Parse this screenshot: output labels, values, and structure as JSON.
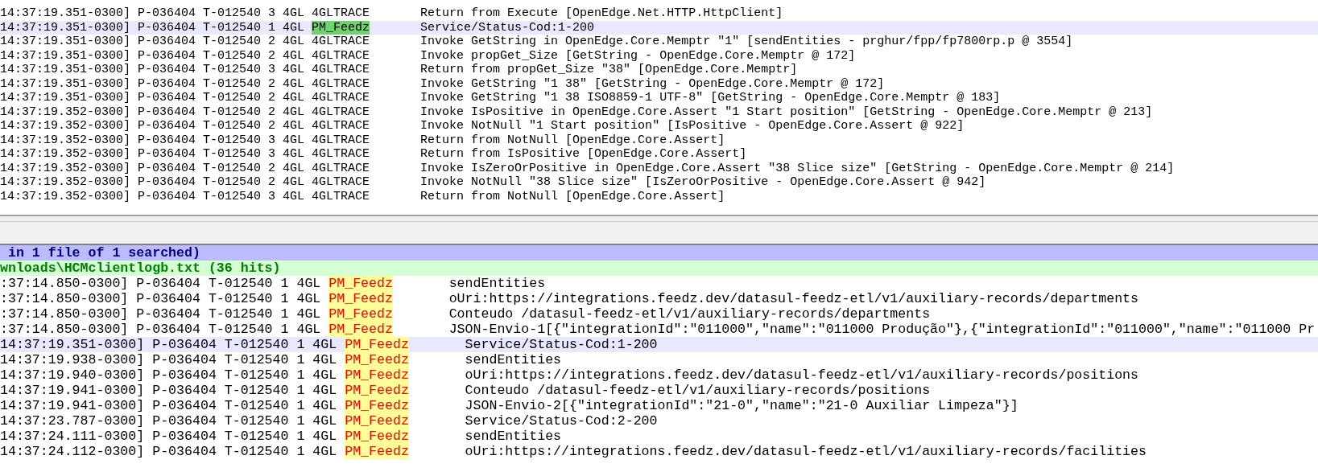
{
  "editor": {
    "lines": [
      {
        "head": "14:37:19.351-0300] P-036404 T-012540 3 4GL",
        "tag": "4GLTRACE",
        "highlighted": false,
        "message": "Return from Execute [OpenEdge.Net.HTTP.HttpClient]",
        "selected": false
      },
      {
        "head": "14:37:19.351-0300] P-036404 T-012540 1 4GL",
        "tag": "PM_Feedz",
        "highlighted": true,
        "message": "Service/Status-Cod:1-200",
        "selected": true
      },
      {
        "head": "14:37:19.351-0300] P-036404 T-012540 2 4GL",
        "tag": "4GLTRACE",
        "highlighted": false,
        "message": "Invoke GetString in OpenEdge.Core.Memptr \"1\" [sendEntities - prghur/fpp/fp7800rp.p @ 3554]",
        "selected": false
      },
      {
        "head": "14:37:19.351-0300] P-036404 T-012540 2 4GL",
        "tag": "4GLTRACE",
        "highlighted": false,
        "message": "Invoke propGet_Size [GetString - OpenEdge.Core.Memptr @ 172]",
        "selected": false
      },
      {
        "head": "14:37:19.351-0300] P-036404 T-012540 3 4GL",
        "tag": "4GLTRACE",
        "highlighted": false,
        "message": "Return from propGet_Size \"38\" [OpenEdge.Core.Memptr]",
        "selected": false
      },
      {
        "head": "14:37:19.351-0300] P-036404 T-012540 2 4GL",
        "tag": "4GLTRACE",
        "highlighted": false,
        "message": "Invoke GetString \"1 38\" [GetString - OpenEdge.Core.Memptr @ 172]",
        "selected": false
      },
      {
        "head": "14:37:19.351-0300] P-036404 T-012540 2 4GL",
        "tag": "4GLTRACE",
        "highlighted": false,
        "message": "Invoke GetString \"1 38 ISO8859-1 UTF-8\" [GetString - OpenEdge.Core.Memptr @ 183]",
        "selected": false
      },
      {
        "head": "14:37:19.352-0300] P-036404 T-012540 2 4GL",
        "tag": "4GLTRACE",
        "highlighted": false,
        "message": "Invoke IsPositive in OpenEdge.Core.Assert \"1 Start position\" [GetString - OpenEdge.Core.Memptr @ 213]",
        "selected": false
      },
      {
        "head": "14:37:19.352-0300] P-036404 T-012540 2 4GL",
        "tag": "4GLTRACE",
        "highlighted": false,
        "message": "Invoke NotNull \"1 Start position\" [IsPositive - OpenEdge.Core.Assert @ 922]",
        "selected": false
      },
      {
        "head": "14:37:19.352-0300] P-036404 T-012540 3 4GL",
        "tag": "4GLTRACE",
        "highlighted": false,
        "message": "Return from NotNull [OpenEdge.Core.Assert]",
        "selected": false
      },
      {
        "head": "14:37:19.352-0300] P-036404 T-012540 3 4GL",
        "tag": "4GLTRACE",
        "highlighted": false,
        "message": "Return from IsPositive [OpenEdge.Core.Assert]",
        "selected": false
      },
      {
        "head": "14:37:19.352-0300] P-036404 T-012540 2 4GL",
        "tag": "4GLTRACE",
        "highlighted": false,
        "message": "Invoke IsZeroOrPositive in OpenEdge.Core.Assert \"38 Slice size\" [GetString - OpenEdge.Core.Memptr @ 214]",
        "selected": false
      },
      {
        "head": "14:37:19.352-0300] P-036404 T-012540 2 4GL",
        "tag": "4GLTRACE",
        "highlighted": false,
        "message": "Invoke NotNull \"38 Slice size\" [IsZeroOrPositive - OpenEdge.Core.Assert @ 942]",
        "selected": false
      },
      {
        "head": "14:37:19.352-0300] P-036404 T-012540 3 4GL",
        "tag": "4GLTRACE",
        "highlighted": false,
        "message": "Return from NotNull [OpenEdge.Core.Assert]",
        "selected": false
      }
    ]
  },
  "search_results": {
    "summary": "in 1 file of 1 searched)",
    "file": "wnloads\\HCMclientlogb.txt (36 hits)",
    "hits": [
      {
        "head": ":37:14.850-0300] P-036404 T-012540 1 4GL",
        "match": "PM_Feedz",
        "message": "sendEntities",
        "selected": false
      },
      {
        "head": ":37:14.850-0300] P-036404 T-012540 1 4GL",
        "match": "PM_Feedz",
        "message": "oUri:https://integrations.feedz.dev/datasul-feedz-etl/v1/auxiliary-records/departments",
        "selected": false
      },
      {
        "head": ":37:14.850-0300] P-036404 T-012540 1 4GL",
        "match": "PM_Feedz",
        "message": "Conteudo /datasul-feedz-etl/v1/auxiliary-records/departments",
        "selected": false
      },
      {
        "head": ":37:14.850-0300] P-036404 T-012540 1 4GL",
        "match": "PM_Feedz",
        "message": "JSON-Envio-1[{\"integrationId\":\"011000\",\"name\":\"011000 Produção\"},{\"integrationId\":\"011000\",\"name\":\"011000 Pr",
        "selected": false
      },
      {
        "head": "14:37:19.351-0300] P-036404 T-012540 1 4GL",
        "match": "PM_Feedz",
        "message": "Service/Status-Cod:1-200",
        "selected": true
      },
      {
        "head": "14:37:19.938-0300] P-036404 T-012540 1 4GL",
        "match": "PM_Feedz",
        "message": "sendEntities",
        "selected": false
      },
      {
        "head": "14:37:19.940-0300] P-036404 T-012540 1 4GL",
        "match": "PM_Feedz",
        "message": "oUri:https://integrations.feedz.dev/datasul-feedz-etl/v1/auxiliary-records/positions",
        "selected": false
      },
      {
        "head": "14:37:19.941-0300] P-036404 T-012540 1 4GL",
        "match": "PM_Feedz",
        "message": "Conteudo /datasul-feedz-etl/v1/auxiliary-records/positions",
        "selected": false
      },
      {
        "head": "14:37:19.941-0300] P-036404 T-012540 1 4GL",
        "match": "PM_Feedz",
        "message": "JSON-Envio-2[{\"integrationId\":\"21-0\",\"name\":\"21-0 Auxiliar Limpeza\"}]",
        "selected": false
      },
      {
        "head": "14:37:23.787-0300] P-036404 T-012540 1 4GL",
        "match": "PM_Feedz",
        "message": "Service/Status-Cod:2-200",
        "selected": false
      },
      {
        "head": "14:37:24.111-0300] P-036404 T-012540 1 4GL",
        "match": "PM_Feedz",
        "message": "sendEntities",
        "selected": false
      },
      {
        "head": "14:37:24.112-0300] P-036404 T-012540 1 4GL",
        "match": "PM_Feedz",
        "message": "oUri:https://integrations.feedz.dev/datasul-feedz-etl/v1/auxiliary-records/facilities",
        "selected": false
      }
    ]
  }
}
